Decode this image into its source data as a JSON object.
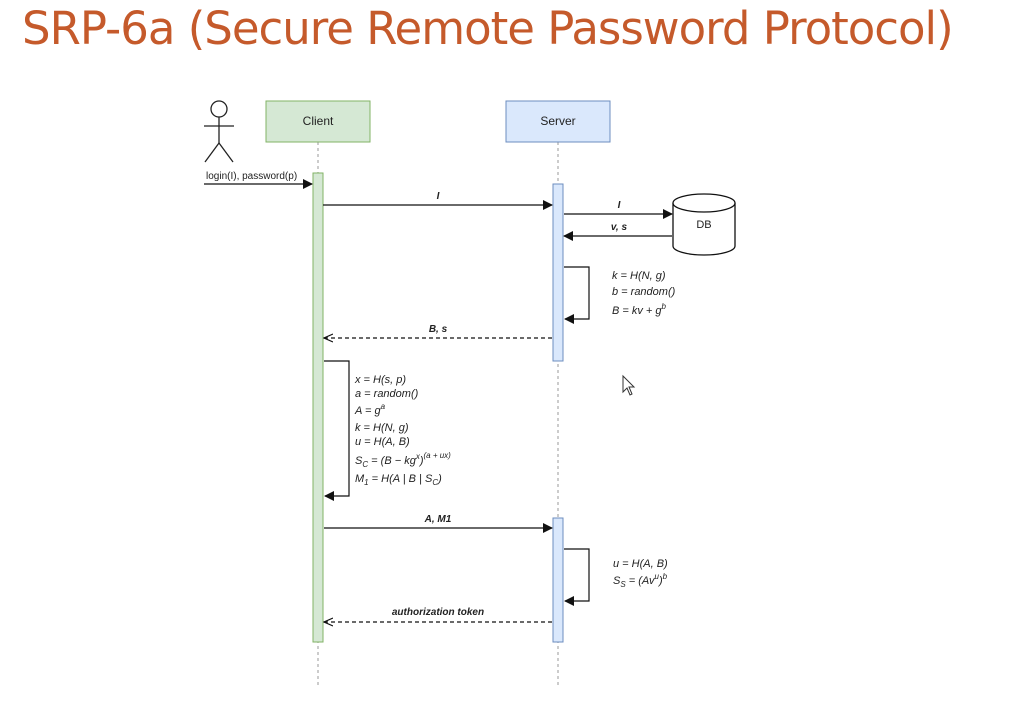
{
  "slide": {
    "title": "SRP-6a (Secure Remote Password Protocol)"
  },
  "colors": {
    "title": "#c55a2b",
    "client_fill": "#d5e8d4",
    "client_stroke": "#82b366",
    "server_fill": "#dae8fc",
    "server_stroke": "#6c8ebf"
  },
  "diagram": {
    "actor_icon": "stick-figure-icon",
    "client_label": "Client",
    "server_label": "Server",
    "db_label": "DB",
    "login_message": "login(I), password(p)",
    "msg_client_to_server_I": "I",
    "msg_server_to_db_I": "I",
    "msg_db_to_server": "v, s",
    "server_calc_1": {
      "line1": "k = H(N, g)",
      "line2": "b = random()",
      "line3_base": "B = kv + g",
      "line3_sup": "b"
    },
    "msg_server_to_client_Bs": "B, s",
    "client_calc": {
      "line1": "x = H(s, p)",
      "line2": "a = random()",
      "line3_base": "A = g",
      "line3_sup": "a",
      "line4": "k = H(N, g)",
      "line5": "u = H(A, B)",
      "line6_s": "S",
      "line6_sub": "C",
      "line6_mid": " = (B − kg",
      "line6_sup1": "x",
      "line6_close": ")",
      "line6_sup2": "(a + ux)",
      "line7_m": "M",
      "line7_sub1": "1",
      "line7_mid": " = H(A | B | S",
      "line7_sub2": "C",
      "line7_close": ")"
    },
    "msg_client_to_server_AM1": "A, M1",
    "server_calc_2": {
      "line1": "u = H(A, B)",
      "line2_s": "S",
      "line2_sub": "S",
      "line2_mid": " = (Av",
      "line2_sup1": "u",
      "line2_close": ")",
      "line2_sup2": "b"
    },
    "msg_auth_token": "authorization token"
  }
}
